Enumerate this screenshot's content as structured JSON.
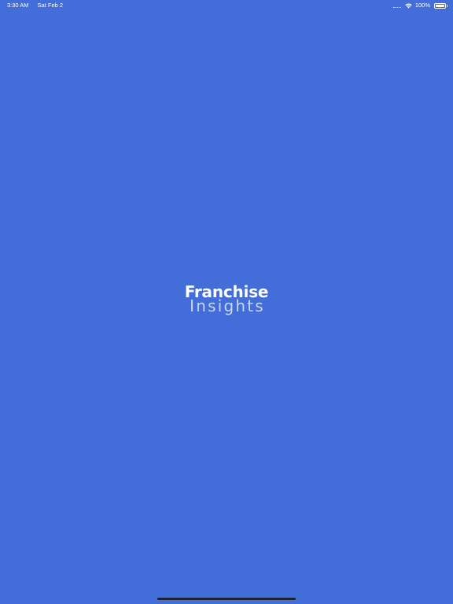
{
  "status_bar": {
    "time": "3:30 AM",
    "date": "Sat Feb 2",
    "battery": "100%",
    "battery_level": 1.0
  },
  "splash": {
    "logo_line1": "Franchise",
    "logo_line2": "Insights"
  },
  "colors": {
    "background": "#436dd8",
    "logo_primary": "#ffffff",
    "logo_secondary": "#c9d6f5",
    "home_indicator": "#1c2330"
  },
  "icons": {
    "signal": "cellular-signal-icon",
    "wifi": "wifi-icon",
    "battery": "battery-icon"
  }
}
